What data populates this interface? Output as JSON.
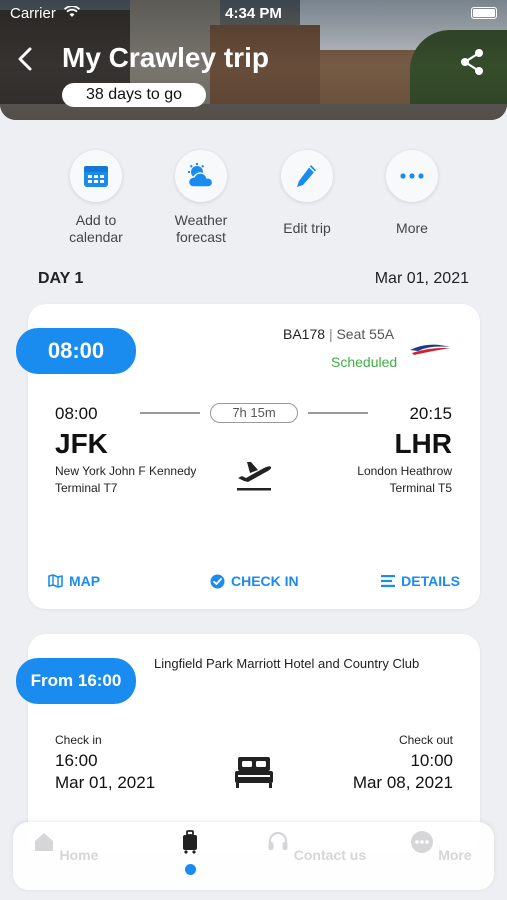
{
  "status_bar": {
    "carrier": "Carrier",
    "time": "4:34 PM"
  },
  "header": {
    "title": "My Crawley trip",
    "countdown": "38 days to go"
  },
  "quick_actions": [
    {
      "label": "Add to calendar",
      "icon": "calendar-icon"
    },
    {
      "label": "Weather forecast",
      "icon": "weather-icon"
    },
    {
      "label": "Edit trip",
      "icon": "pencil-icon"
    },
    {
      "label": "More",
      "icon": "ellipsis-icon"
    }
  ],
  "day": {
    "label": "DAY 1",
    "date": "Mar 01, 2021"
  },
  "flight": {
    "time_pill": "08:00",
    "flight_number": "BA178",
    "separator": "|",
    "seat": "Seat 55A",
    "status": "Scheduled",
    "departure": {
      "time": "08:00",
      "code": "JFK",
      "airport": "New York John F Kennedy",
      "terminal": "Terminal T7"
    },
    "arrival": {
      "time": "20:15",
      "code": "LHR",
      "airport": "London Heathrow",
      "terminal": "Terminal T5"
    },
    "duration": "7h 15m",
    "actions": {
      "map": "MAP",
      "check_in": "CHECK IN",
      "details": "DETAILS"
    }
  },
  "hotel": {
    "time_pill": "From 16:00",
    "name": "Lingfield Park Marriott Hotel and Country Club",
    "check_in": {
      "label": "Check in",
      "time": "16:00",
      "date": "Mar 01, 2021"
    },
    "check_out": {
      "label": "Check out",
      "time": "10:00",
      "date": "Mar 08, 2021"
    }
  },
  "tab_bar": {
    "items": [
      {
        "label": "Home",
        "icon": "home-icon"
      },
      {
        "label": "",
        "icon": "luggage-icon",
        "active": true
      },
      {
        "label": "Contact us",
        "icon": "headset-icon"
      },
      {
        "label": "More",
        "icon": "ellipsis-icon"
      }
    ]
  },
  "colors": {
    "accent": "#1a8cf0",
    "status_scheduled": "#3cb043",
    "background": "#eeeff3"
  }
}
